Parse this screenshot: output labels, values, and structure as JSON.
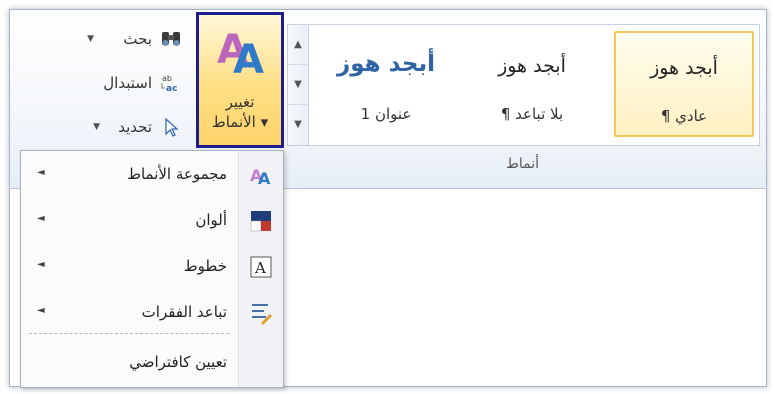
{
  "ribbon": {
    "styles_group": {
      "label": "أنماط",
      "items": [
        {
          "sample": "أبجد هوز",
          "name": "¶ عادي",
          "selected": true,
          "heading": false
        },
        {
          "sample": "أبجد هوز",
          "name": "¶ بلا تباعد",
          "selected": false,
          "heading": false
        },
        {
          "sample": "أبجد هوز",
          "name": "عنوان 1",
          "selected": false,
          "heading": true
        }
      ],
      "scroll": {
        "up": "▲",
        "down": "▼",
        "more": "▼"
      }
    },
    "change_styles": {
      "line1": "تغيير",
      "line2": "الأنماط ▾"
    },
    "editing": {
      "find": {
        "label": "بحث",
        "arrow": "▼"
      },
      "replace": {
        "label": "استبدال"
      },
      "select": {
        "label": "تحديد",
        "arrow": "▼"
      }
    }
  },
  "menu": {
    "items": [
      {
        "label": "مجموعة الأنماط",
        "arrow": "◄",
        "icon": "style-set-icon"
      },
      {
        "label": "ألوان",
        "arrow": "◄",
        "icon": "colors-icon"
      },
      {
        "label": "خطوط",
        "arrow": "◄",
        "icon": "fonts-icon"
      },
      {
        "label": "تباعد الفقرات",
        "arrow": "◄",
        "icon": "paragraph-spacing-icon"
      },
      {
        "label": "تعيين كافتراضي",
        "arrow": "",
        "icon": ""
      }
    ]
  },
  "colors": {
    "highlight_border": "#1e1e8a",
    "selected_style_border": "#f2c85a",
    "heading_blue": "#2e63a6"
  }
}
